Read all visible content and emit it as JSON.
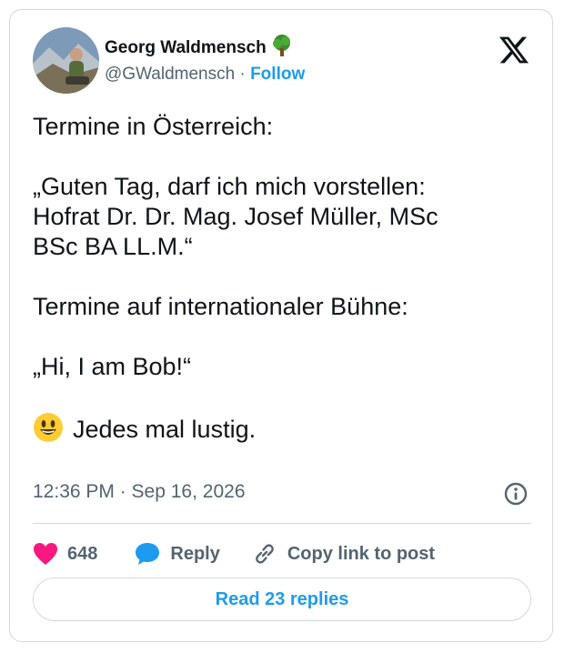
{
  "author": {
    "name": "Georg Waldmensch",
    "name_emoji_icon": "tree-icon",
    "handle": "@GWaldmensch",
    "separator": "·",
    "follow_label": "Follow"
  },
  "tweet": {
    "lines": [
      "Termine in Österreich:",
      "„Guten Tag, darf ich mich vorstellen:",
      "Hofrat Dr. Dr. Mag. Josef Müller, MSc",
      "BSc BA LL.M.“",
      "Termine auf internationaler Bühne:",
      "„Hi, I am Bob!“",
      "Jedes mal lustig."
    ],
    "smiley_icon": "grinning-face-icon"
  },
  "meta": {
    "timestamp": "12:36 PM · Sep 16, 2026",
    "info_icon": "info-icon"
  },
  "actions": {
    "like_count": "648",
    "reply_label": "Reply",
    "copy_label": "Copy link to post"
  },
  "replies_button": {
    "label": "Read 23 replies"
  },
  "colors": {
    "accent": "#1d9bf0",
    "like": "#f91880",
    "muted": "#536471",
    "border": "#cfd9de"
  }
}
